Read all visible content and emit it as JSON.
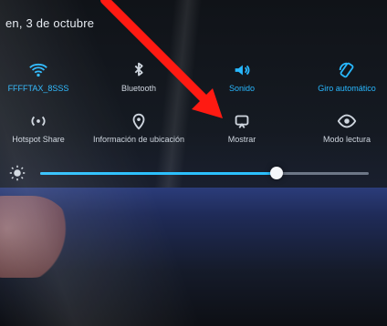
{
  "status": {
    "date": "en, 3 de octubre"
  },
  "quick_settings": {
    "row1": [
      {
        "name": "wifi",
        "label": "FFFFTAX_8SSS",
        "active": true,
        "icon": "wifi-icon"
      },
      {
        "name": "bluetooth",
        "label": "Bluetooth",
        "active": true,
        "icon": "bluetooth-icon"
      },
      {
        "name": "sound",
        "label": "Sonido",
        "active": true,
        "icon": "sound-icon"
      },
      {
        "name": "rotate",
        "label": "Giro automático",
        "active": true,
        "icon": "rotate-icon"
      }
    ],
    "row2": [
      {
        "name": "hotspot",
        "label": "Hotspot Share",
        "active": false,
        "icon": "hotspot-icon"
      },
      {
        "name": "location",
        "label": "Información de ubicación",
        "active": false,
        "icon": "location-icon"
      },
      {
        "name": "cast",
        "label": "Mostrar",
        "active": false,
        "icon": "cast-icon"
      },
      {
        "name": "reading",
        "label": "Modo lectura",
        "active": false,
        "icon": "eye-icon"
      }
    ]
  },
  "brightness": {
    "value": 0.72
  },
  "colors": {
    "accent": "#28b8ff",
    "arrow": "#ff1a12"
  }
}
